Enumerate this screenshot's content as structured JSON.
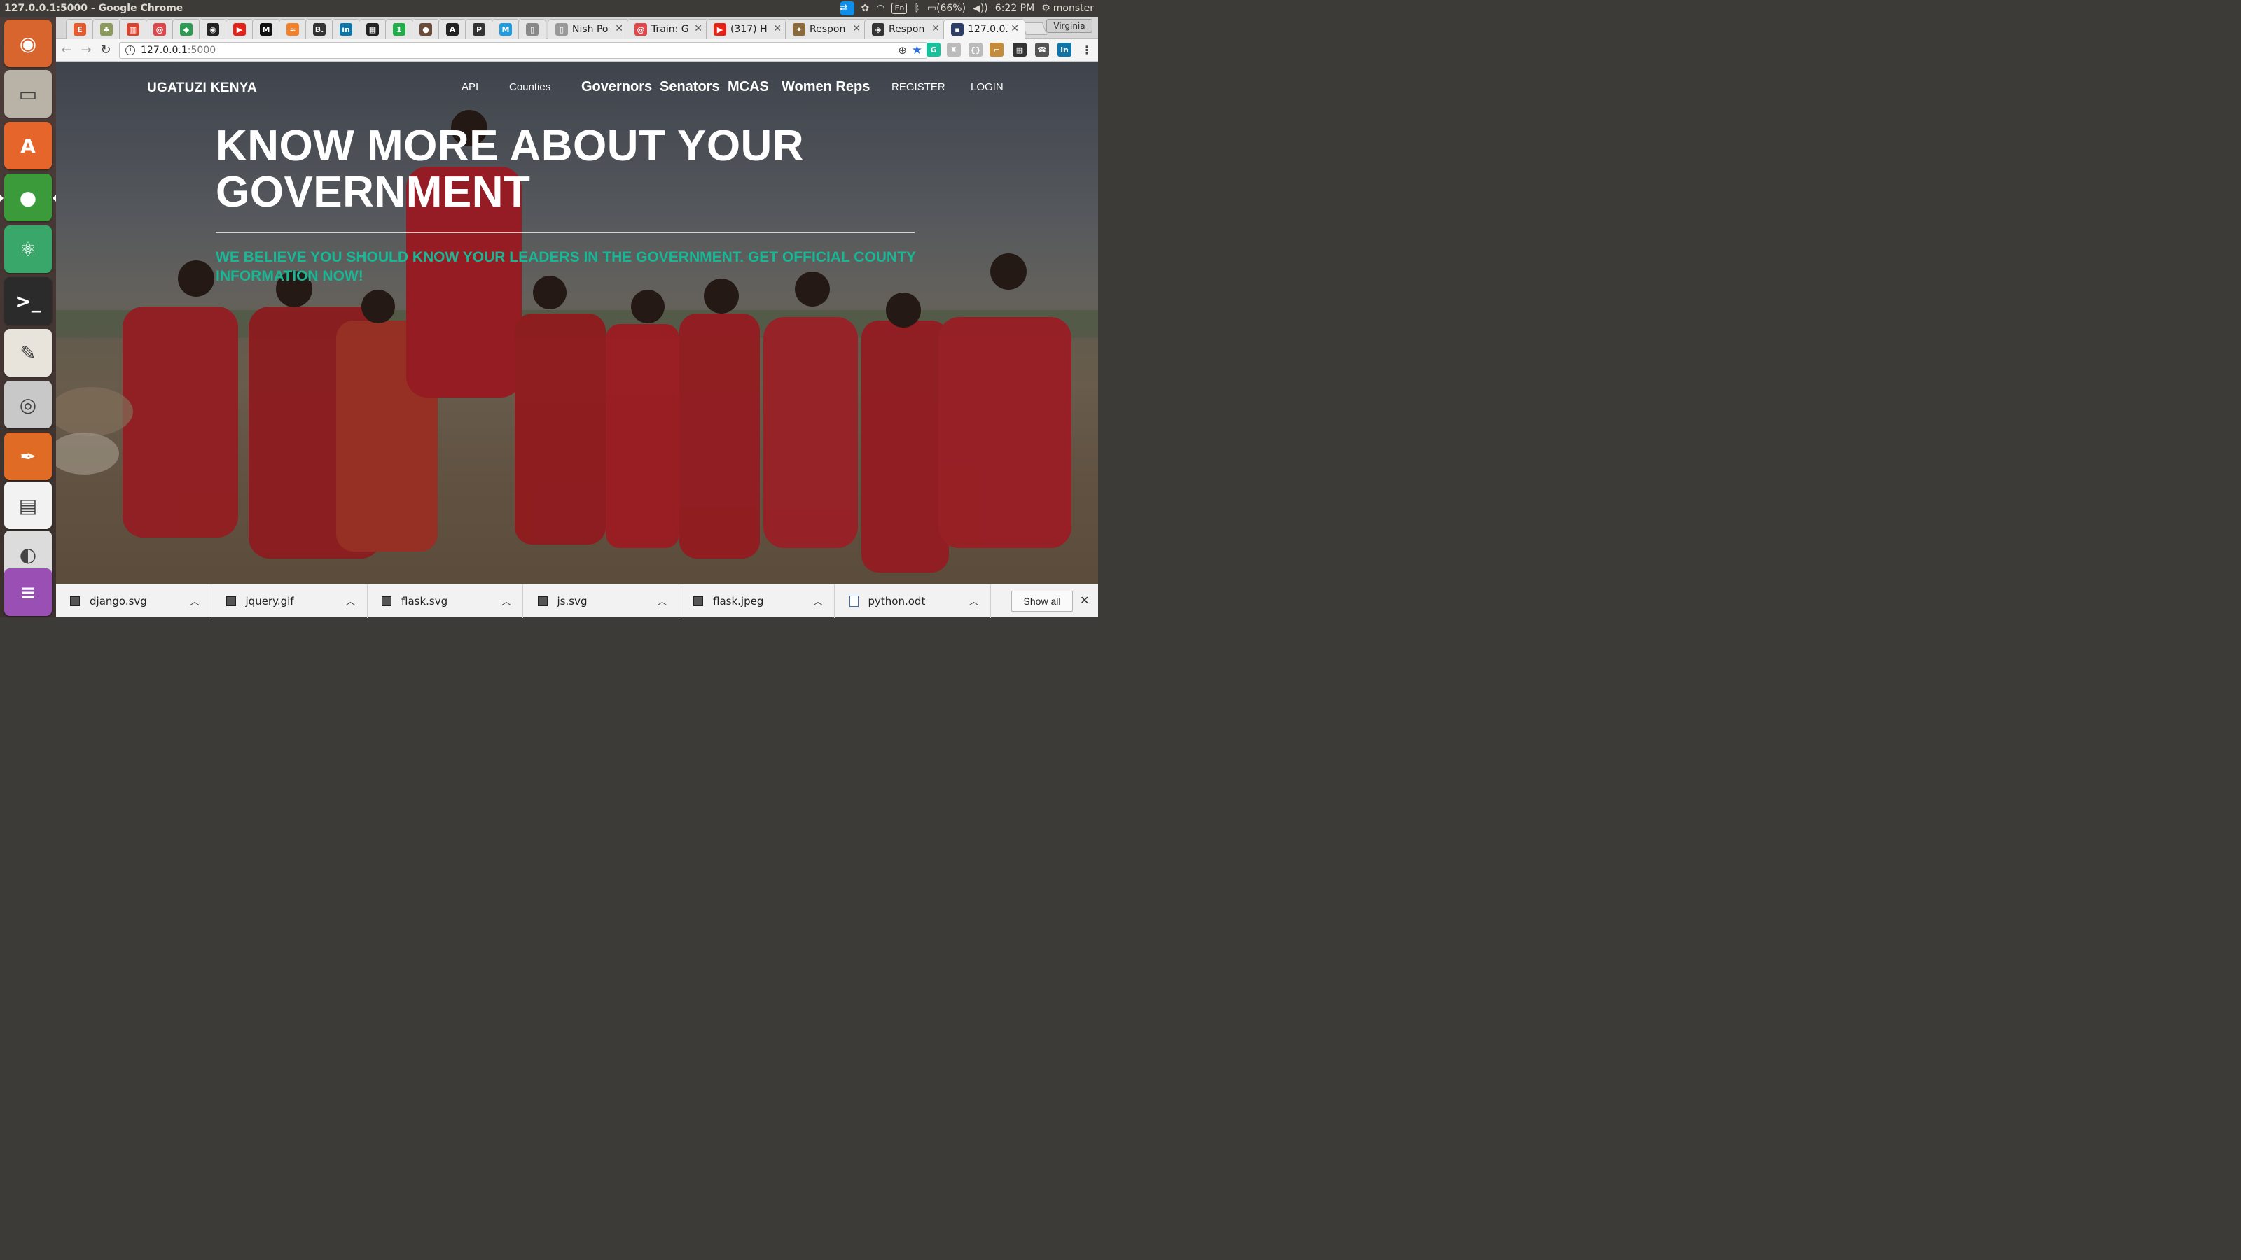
{
  "panel": {
    "window_title": "127.0.0.1:5000 - Google Chrome",
    "keyboard": "En",
    "battery": "(66%)",
    "time": "6:22 PM",
    "user": "monster"
  },
  "launcher": {
    "items": [
      {
        "name": "ubuntu-dash-icon",
        "glyph": "◉",
        "color": "#d8642e"
      },
      {
        "name": "files-icon",
        "glyph": "▭",
        "color": "#b9b2a6"
      },
      {
        "name": "software-center-icon",
        "glyph": "A",
        "color": "#e5652b"
      },
      {
        "name": "chrome-icon",
        "glyph": "●",
        "color": "#3b9b3b"
      },
      {
        "name": "atom-icon",
        "glyph": "⚛",
        "color": "#3aa76a"
      },
      {
        "name": "terminal-icon",
        "glyph": ">_",
        "color": "#2b2b2b"
      },
      {
        "name": "text-editor-icon",
        "glyph": "✎",
        "color": "#e8e4dc"
      },
      {
        "name": "camera-icon",
        "glyph": "◎",
        "color": "#c8c8c8"
      },
      {
        "name": "inkscape-icon",
        "glyph": "✒",
        "color": "#e06b25"
      },
      {
        "name": "impress-icon",
        "glyph": "▤",
        "color": "#f2f2f2"
      },
      {
        "name": "gimp-icon",
        "glyph": "◐",
        "color": "#dcdcdc"
      },
      {
        "name": "stack-icon",
        "glyph": "≡",
        "color": "#9a4fb5"
      }
    ]
  },
  "browser": {
    "pinned_tabs": [
      {
        "icon": "e-icon",
        "letter": "E",
        "color": "#e85a2b"
      },
      {
        "icon": "tree-icon",
        "letter": "♣",
        "color": "#8b9b5c"
      },
      {
        "icon": "trello-icon",
        "letter": "▥",
        "color": "#d8442f"
      },
      {
        "icon": "swirl-icon",
        "letter": "@",
        "color": "#e0474c"
      },
      {
        "icon": "hangouts-icon",
        "letter": "◆",
        "color": "#2e9b55"
      },
      {
        "icon": "github-icon",
        "letter": "◉",
        "color": "#222222"
      },
      {
        "icon": "youtube-icon",
        "letter": "▶",
        "color": "#e62117"
      },
      {
        "icon": "medium-icon",
        "letter": "M",
        "color": "#111111"
      },
      {
        "icon": "flame-icon",
        "letter": "≈",
        "color": "#f4802a"
      },
      {
        "icon": "b-icon",
        "letter": "B.",
        "color": "#333333"
      },
      {
        "icon": "linkedin-icon",
        "letter": "in",
        "color": "#0e76a8"
      },
      {
        "icon": "trello-board-icon",
        "letter": "▦",
        "color": "#222222"
      },
      {
        "icon": "one-icon",
        "letter": "1",
        "color": "#1fae4a"
      },
      {
        "icon": "avatar-icon",
        "letter": "●",
        "color": "#6b4c3b"
      },
      {
        "icon": "a-icon",
        "letter": "A",
        "color": "#222222"
      },
      {
        "icon": "p-icon",
        "letter": "P",
        "color": "#333333"
      },
      {
        "icon": "m-icon",
        "letter": "M",
        "color": "#1f9de0"
      },
      {
        "icon": "doc-icon",
        "letter": "▯",
        "color": "#888888"
      }
    ],
    "tabs": [
      {
        "label": "Nish Po",
        "icon": "doc-icon",
        "letter": "▯",
        "color": "#999999"
      },
      {
        "label": "Train: G",
        "icon": "swirl-icon",
        "letter": "@",
        "color": "#e0474c"
      },
      {
        "label": "(317) H",
        "icon": "youtube-icon",
        "letter": "▶",
        "color": "#e62117"
      },
      {
        "label": "Respon",
        "icon": "tool-icon",
        "letter": "✦",
        "color": "#8a6a3a"
      },
      {
        "label": "Respon",
        "icon": "codepen-icon",
        "letter": "◈",
        "color": "#333333"
      },
      {
        "label": "127.0.0.",
        "icon": "terminal-small-icon",
        "letter": "▪",
        "color": "#2c3e66"
      }
    ],
    "profile": "Virginia",
    "url_host": "127.0.0.1",
    "url_port": ":5000",
    "extensions": [
      {
        "icon": "grammarly-icon",
        "letter": "G",
        "color": "#15c39a"
      },
      {
        "icon": "bell-icon",
        "letter": "♜",
        "color": "#bbbbbb"
      },
      {
        "icon": "json-icon",
        "letter": "{}",
        "color": "#bbbbbb"
      },
      {
        "icon": "hammer-icon",
        "letter": "⌐",
        "color": "#c58b3a"
      },
      {
        "icon": "film-icon",
        "letter": "▦",
        "color": "#333333"
      },
      {
        "icon": "phone-icon",
        "letter": "☎",
        "color": "#555555"
      },
      {
        "icon": "linkedin-ext-icon",
        "letter": "in",
        "color": "#0e76a8"
      }
    ]
  },
  "site": {
    "brand": "UGATUZI KENYA",
    "nav": {
      "api": "API",
      "counties": "Counties",
      "governors": "Governors",
      "senators": "Senators",
      "mcas": "MCAS",
      "women_reps": "Women Reps",
      "register": "REGISTER",
      "login": "LOGIN"
    },
    "hero_title": "KNOW MORE ABOUT YOUR GOVERNMENT",
    "hero_subtitle": "WE BELIEVE YOU SHOULD KNOW YOUR LEADERS IN THE GOVERNMENT. GET OFFICIAL COUNTY INFORMATION NOW!",
    "accent_color": "#18b897"
  },
  "downloads": {
    "items": [
      {
        "file": "django.svg",
        "type": "image"
      },
      {
        "file": "jquery.gif",
        "type": "image"
      },
      {
        "file": "flask.svg",
        "type": "image"
      },
      {
        "file": "js.svg",
        "type": "image"
      },
      {
        "file": "flask.jpeg",
        "type": "image"
      },
      {
        "file": "python.odt",
        "type": "document"
      }
    ],
    "show_all": "Show all"
  }
}
